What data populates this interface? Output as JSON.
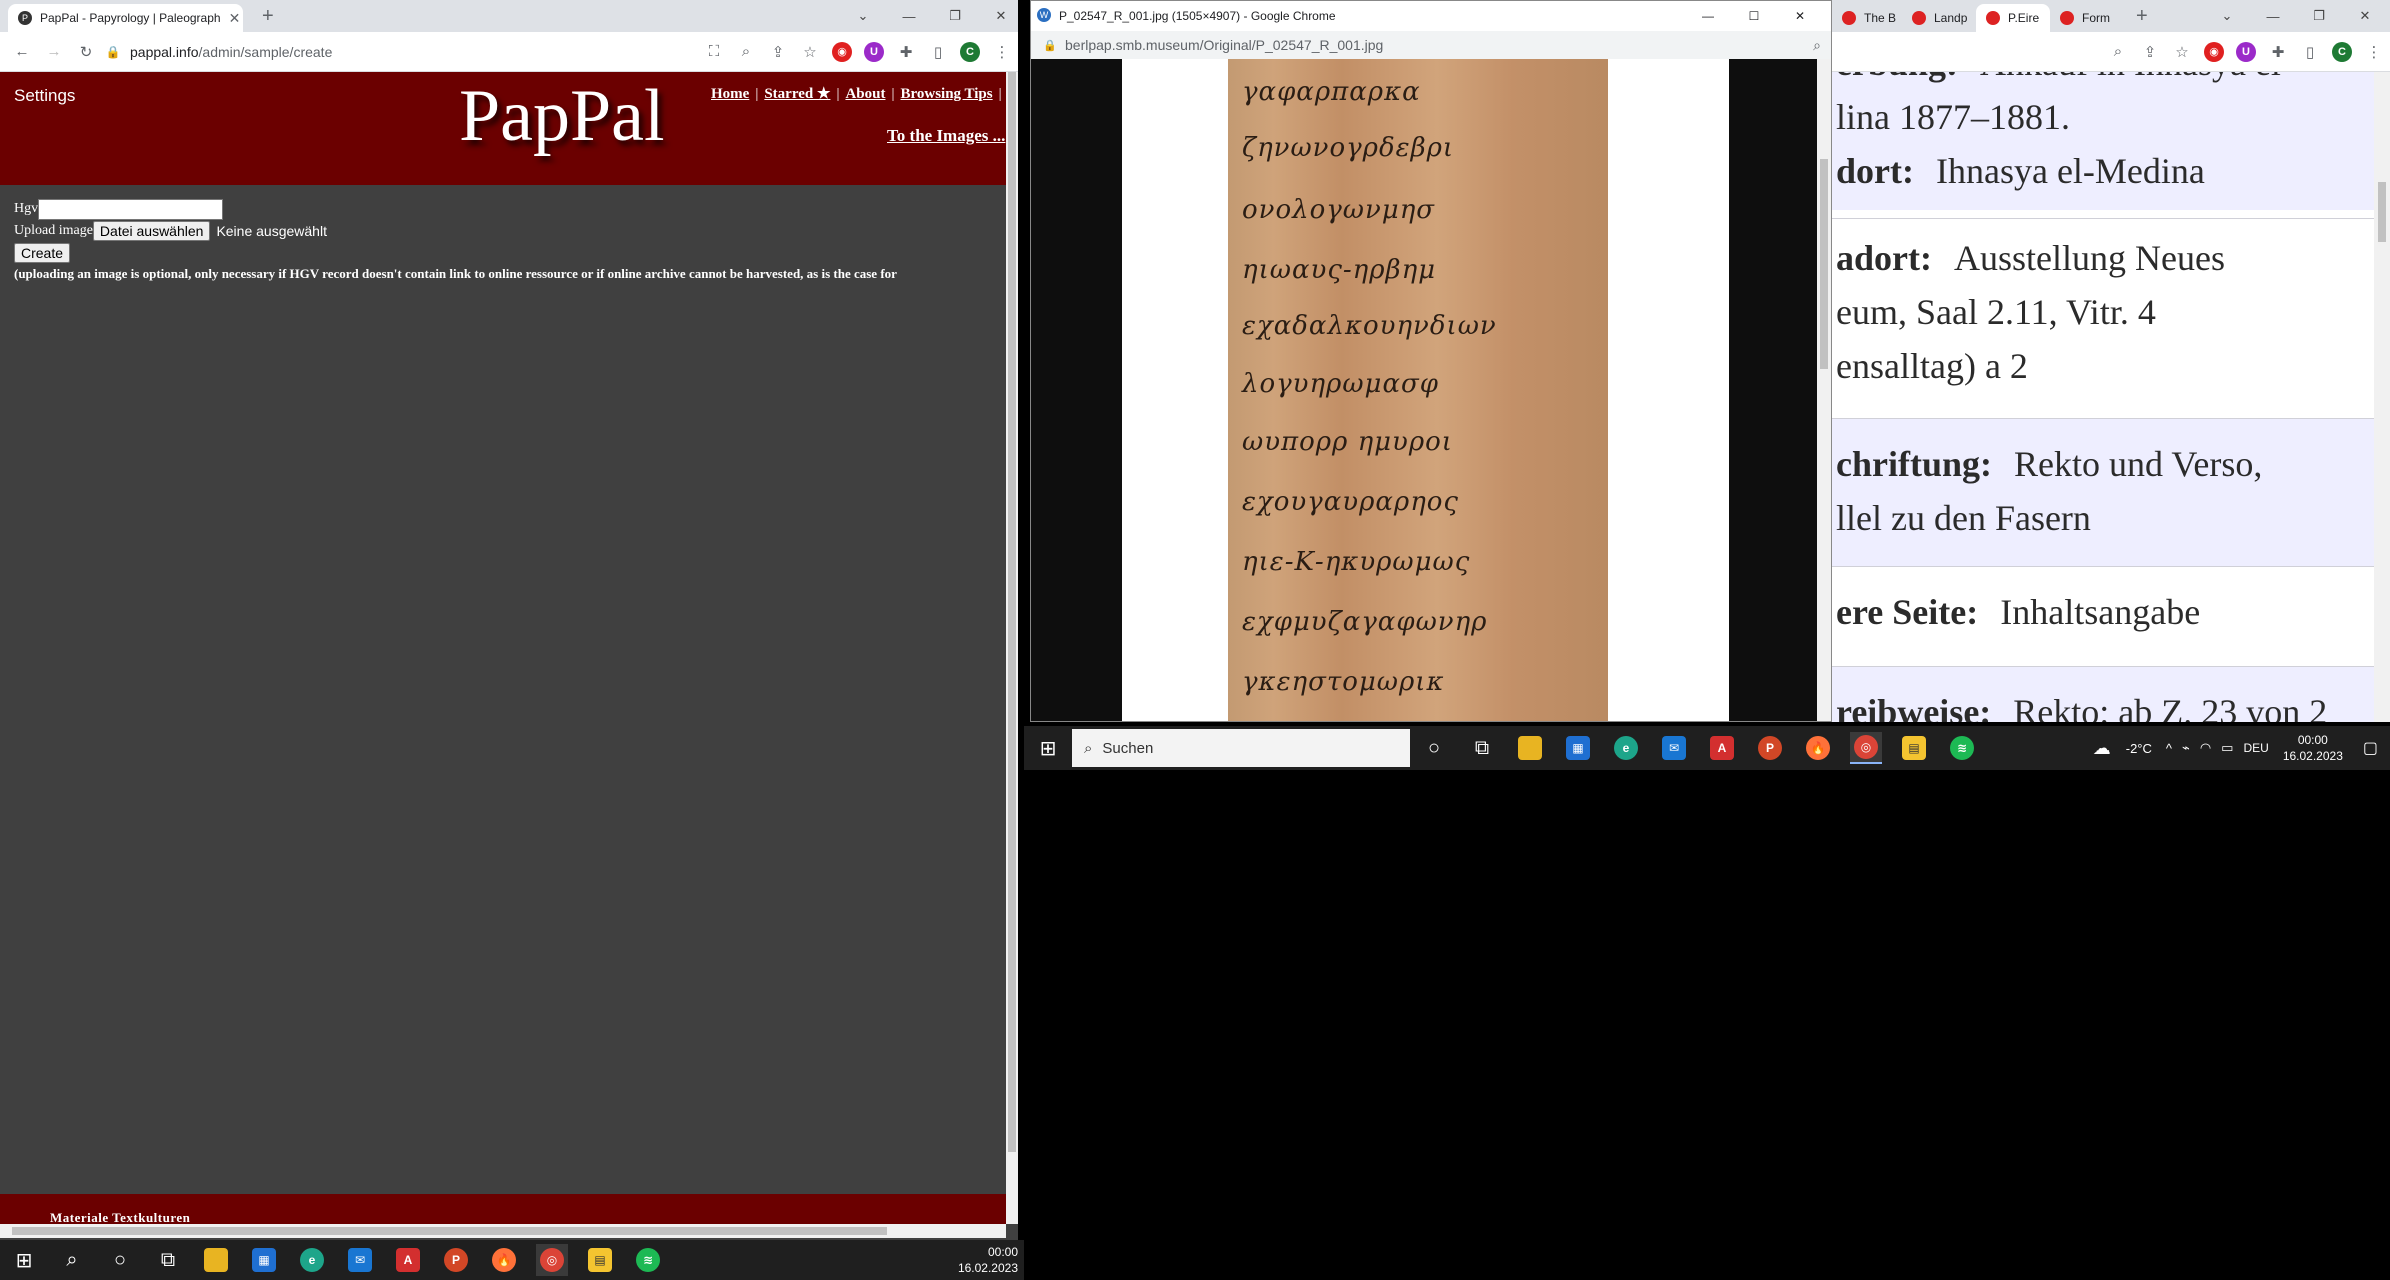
{
  "left_browser": {
    "tab_title": "PapPal - Papyrology | Paleograph",
    "url_host": "pappal.info",
    "url_path": "/admin/sample/create",
    "profile_letter": "C"
  },
  "pappal": {
    "settings_label": "Settings",
    "logo": "PapPal",
    "nav": [
      "Home",
      "Starred ★",
      "About",
      "Browsing Tips"
    ],
    "to_images": "To the Images ...",
    "hgv_label": "Hgv",
    "upload_label": "Upload image",
    "choose_file_button": "Datei auswählen",
    "no_file_text": "Keine ausgewählt",
    "create_button": "Create",
    "note": "(uploading an image is optional, only necessary if HGV record doesn't contain link to online ressource or if online archive cannot be harvested, as is the case for",
    "footer_text": "Materiale Textkulturen"
  },
  "image_window": {
    "title": "P_02547_R_001.jpg (1505×4907) - Google Chrome",
    "url_host": "berlpap.smb.museum",
    "url_path": "/Original/P_02547_R_001.jpg",
    "greek_lines": [
      "γαφαρπαρκα",
      "ζηνωνογρδεβρι",
      "ονολογωνμησ",
      "ηιωαυς-ηρβημ",
      "εχαδαλκουηνδιων",
      "λογυηρωμασφ",
      "ωυπορρ ημυροι",
      "εχουγαυραρηος",
      "ηιε-Κ-ηκυρωμως",
      "εχφμυζαγαφωνηρ",
      "γκεηστομωρικ"
    ]
  },
  "right_browser": {
    "tabs": [
      "The B",
      "Landp",
      "P.Eire",
      "Form"
    ],
    "rows": [
      {
        "label": "erbung:",
        "value": "Ankauf in Ihnasya el",
        "extra": "lina 1877–1881."
      },
      {
        "label": "dort:",
        "value": "Ihnasya el-Medina"
      },
      {
        "label": "adort:",
        "value": "Ausstellung Neues",
        "extra": "eum, Saal 2.11, Vitr. 4",
        "extra2": "ensalltag) a 2"
      },
      {
        "label": "chriftung:",
        "value": "Rekto und Verso,",
        "extra": "llel zu den Fasern"
      },
      {
        "label": "ere Seite:",
        "value": "Inhaltsangabe"
      },
      {
        "label": "reibweise:",
        "value": "Rekto: ab Z. 23 von 2"
      }
    ]
  },
  "taskbar_right": {
    "search_placeholder": "Suchen",
    "weather": "-2°C",
    "lang": "DEU",
    "time": "00:00",
    "date": "16.02.2023"
  },
  "taskbar_left": {
    "time": "00:00",
    "date": "16.02.2023"
  },
  "colors": {
    "pappal_red": "#6b0000",
    "pappal_bg": "#404040"
  }
}
